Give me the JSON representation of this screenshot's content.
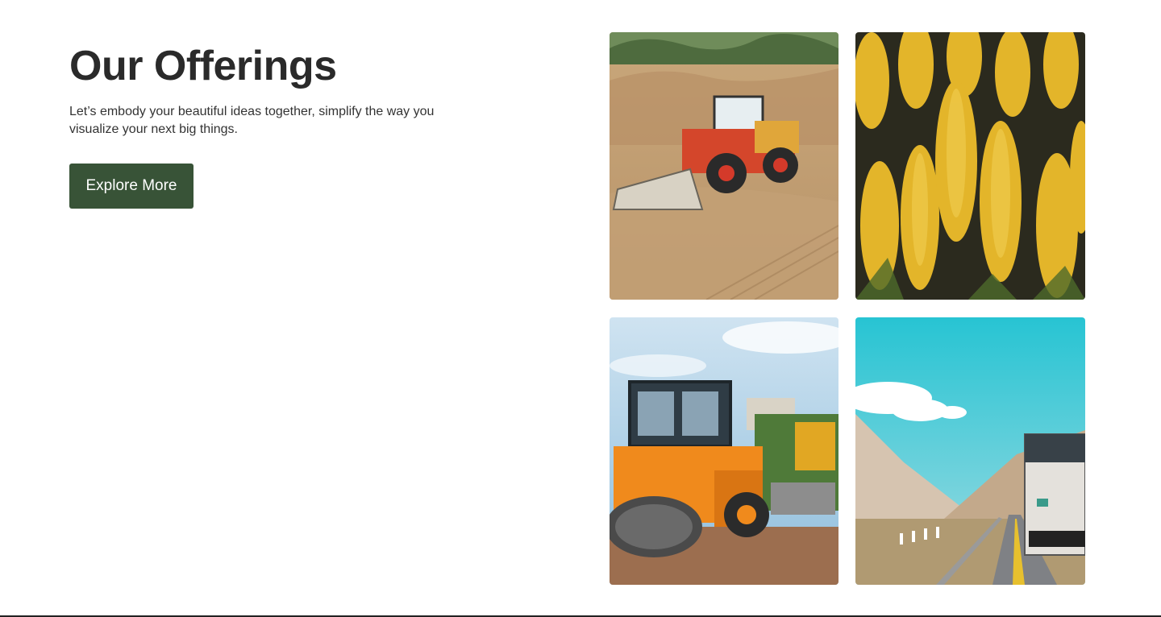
{
  "section": {
    "title": "Our Offerings",
    "subtitle": "Let’s embody your beautiful ideas together, simplify the way you visualize your next big things.",
    "cta_label": "Explore More"
  },
  "gallery": [
    {
      "name": "wheel-loader-photo",
      "alt": "wheel loader in sand pit"
    },
    {
      "name": "corn-photo",
      "alt": "corn cobs"
    },
    {
      "name": "road-roller-photo",
      "alt": "road roller at construction site"
    },
    {
      "name": "truck-road-photo",
      "alt": "truck on mountain road"
    }
  ],
  "colors": {
    "accent": "#385337",
    "text": "#2a2a2a"
  }
}
